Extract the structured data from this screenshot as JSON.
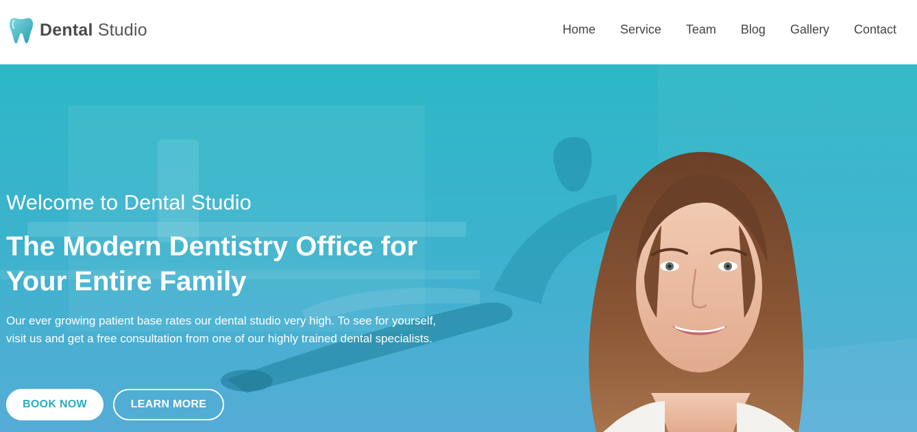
{
  "brand": {
    "name_bold": "Dental",
    "name_light": " Studio",
    "logo_icon": "tooth-icon",
    "accent_color": "#2fb8c6"
  },
  "nav": {
    "items": [
      {
        "label": "Home"
      },
      {
        "label": "Service"
      },
      {
        "label": "Team"
      },
      {
        "label": "Blog"
      },
      {
        "label": "Gallery"
      },
      {
        "label": "Contact"
      }
    ]
  },
  "hero": {
    "welcome": "Welcome to Dental Studio",
    "headline": "The Modern Dentistry Office for Your Entire Family",
    "description": "Our ever growing patient base rates our dental studio very high. To see for yourself, visit us and get a free consultation from one of our highly trained dental specialists.",
    "book_now_label": "BOOK NOW",
    "learn_more_label": "LEARN MORE",
    "background": "dental-office-photo",
    "portrait": "smiling-woman-photo"
  }
}
